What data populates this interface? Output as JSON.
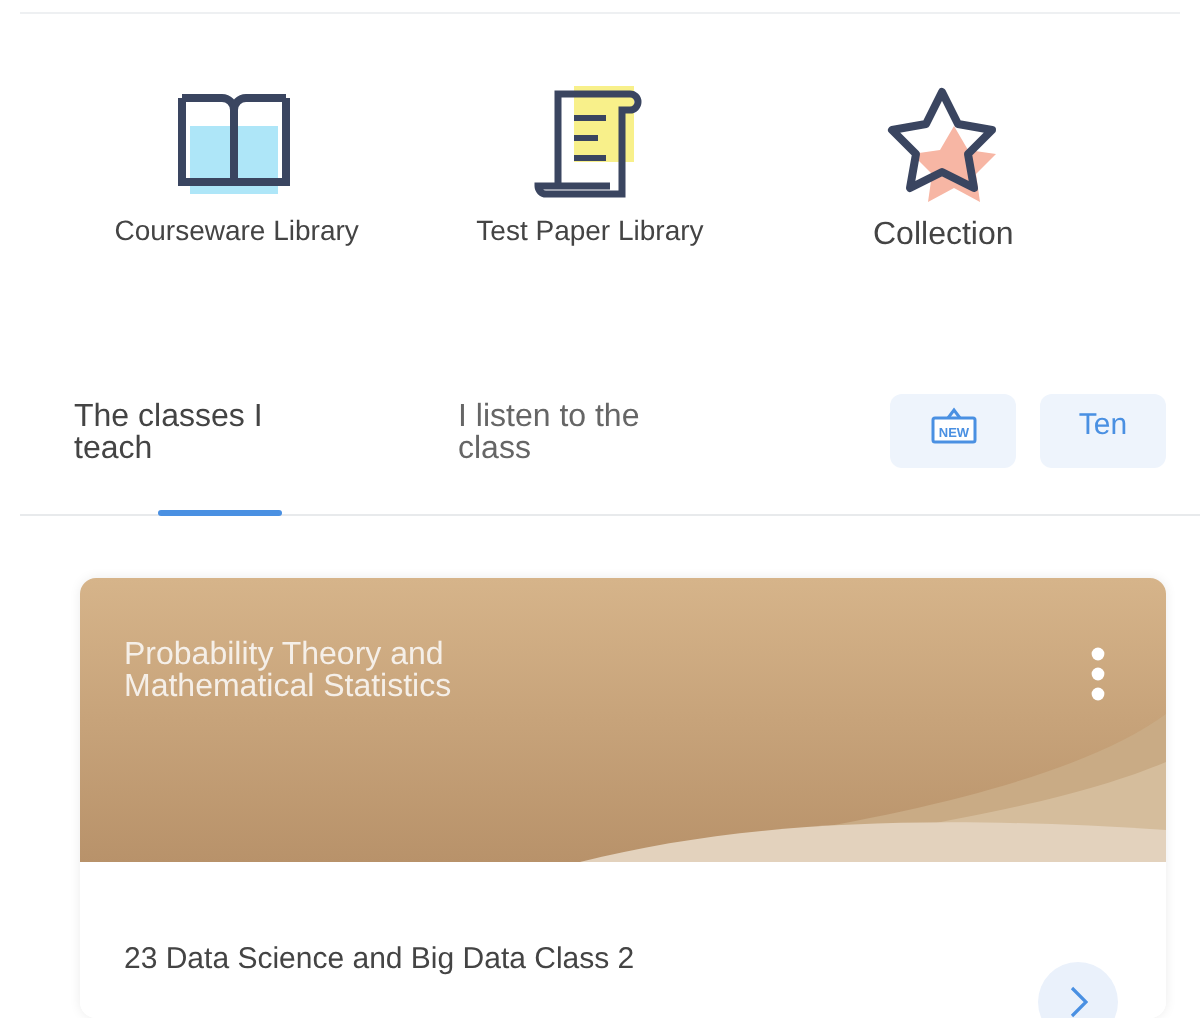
{
  "shortcuts": [
    {
      "kind": "book",
      "label": "Courseware Library"
    },
    {
      "kind": "scroll",
      "label": "Test Paper Library"
    },
    {
      "kind": "star",
      "label": "Collection"
    }
  ],
  "tabs": [
    {
      "label": "The classes I teach",
      "selected": true
    },
    {
      "label": "I listen to the class",
      "selected": false
    }
  ],
  "actions": [
    {
      "kind": "new-icon",
      "label": "NEW"
    },
    {
      "kind": "text",
      "label": "Ten"
    }
  ],
  "course_card": {
    "title": "Probability Theory and Mathematical Statistics",
    "class_name": "23 Data Science and Big Data Class 2"
  }
}
